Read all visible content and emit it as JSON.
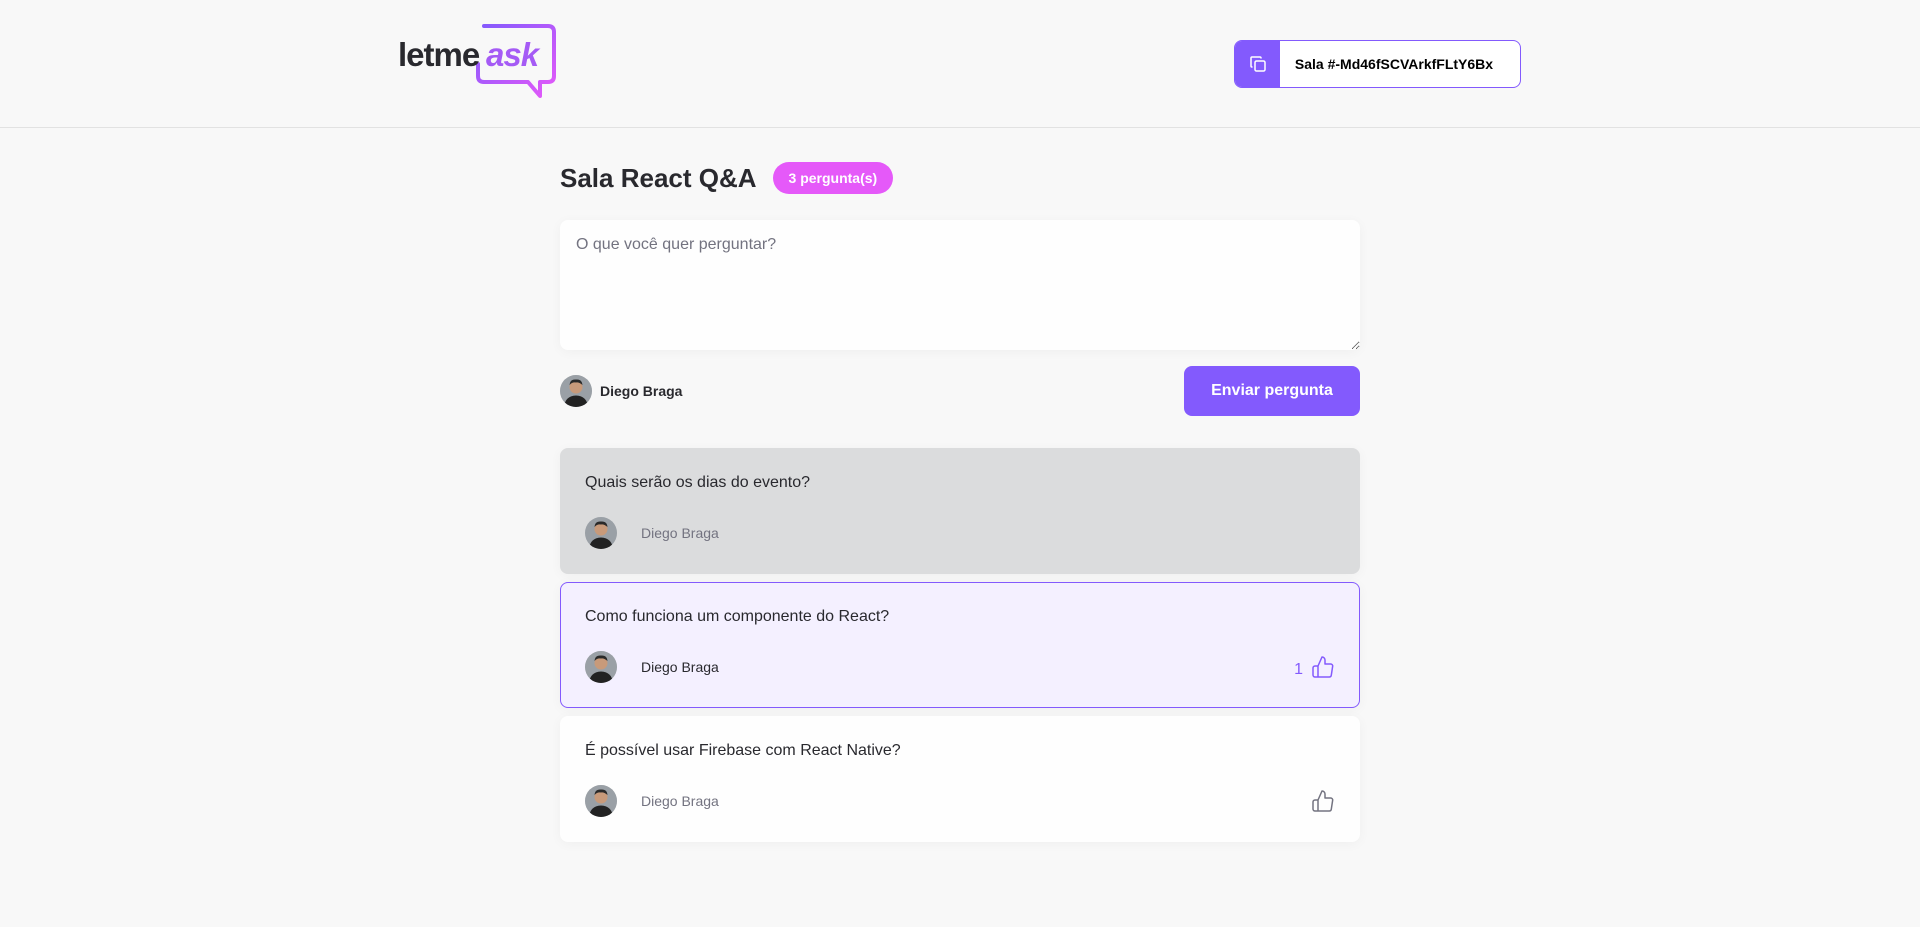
{
  "header": {
    "logo_text": "letme",
    "logo_accent": "ask",
    "room_code_label": "Sala #-Md46fSCVArkfFLtY6Bx"
  },
  "room": {
    "title": "Sala React Q&A",
    "question_count": "3 pergunta(s)"
  },
  "form": {
    "placeholder": "O que você quer perguntar?",
    "user_name": "Diego Braga",
    "submit_label": "Enviar pergunta"
  },
  "questions": [
    {
      "content": "Quais serão os dias do evento?",
      "author": "Diego Braga",
      "state": "answered",
      "likes": ""
    },
    {
      "content": "Como funciona um componente do React?",
      "author": "Diego Braga",
      "state": "highlighted",
      "likes": "1"
    },
    {
      "content": "É possível usar Firebase com React Native?",
      "author": "Diego Braga",
      "state": "default",
      "likes": ""
    }
  ],
  "colors": {
    "primary": "#835afd",
    "badge": "#e559f9",
    "answered_bg": "#dbdcdd",
    "highlighted_bg": "#f4f0ff"
  },
  "icons": {
    "copy": "copy-icon",
    "like": "like-icon"
  }
}
